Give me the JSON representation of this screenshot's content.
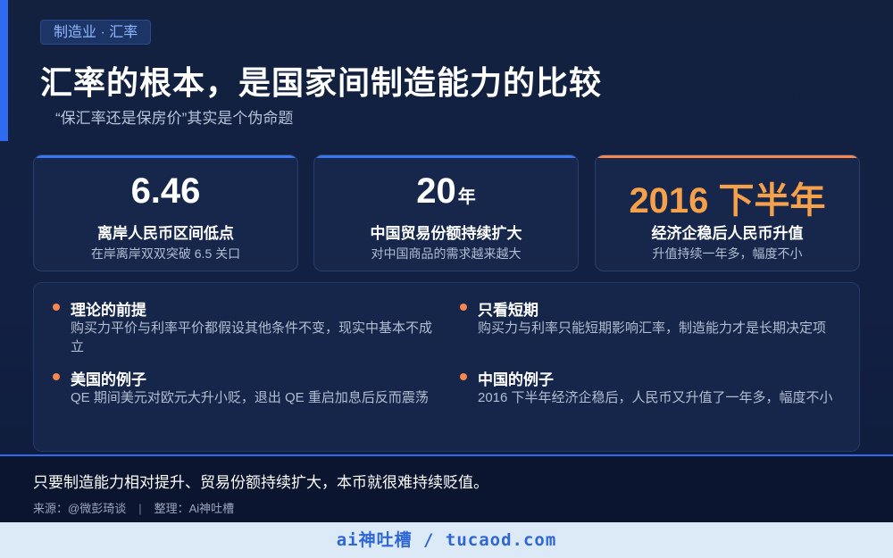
{
  "header": {
    "tag": "制造业 · 汇率",
    "title": "汇率的根本，是国家间制造能力的比较",
    "subtitle": "“保汇率还是保房价”其实是个伪命题"
  },
  "stats": [
    {
      "value": "6.46",
      "unit": "",
      "label": "离岸人民币区间低点",
      "desc": "在岸离岸双双突破 6.5 关口"
    },
    {
      "value": "20",
      "unit": "年",
      "label": "中国贸易份额持续扩大",
      "desc": "对中国商品的需求越来越大"
    },
    {
      "value": "2016 下半年",
      "unit": "",
      "label": "经济企稳后人民币升值",
      "desc": "升值持续一年多，幅度不小"
    }
  ],
  "points": [
    {
      "heading": "理论的前提",
      "body": "购买力平价与利率平价都假设其他条件不变，现实中基本不成立"
    },
    {
      "heading": "只看短期",
      "body": "购买力与利率只能短期影响汇率，制造能力才是长期决定项"
    },
    {
      "heading": "美国的例子",
      "body": "QE 期间美元对欧元大升小贬，退出 QE 重启加息后反而震荡"
    },
    {
      "heading": "中国的例子",
      "body": "2016 下半年经济企稳后，人民币又升值了一年多，幅度不小"
    }
  ],
  "bottom": {
    "quote": "只要制造能力相对提升、贸易份额持续扩大，本币就很难持续贬值。",
    "source": "来源：@微彭琦谈",
    "separator": "|",
    "editor": "整理：Ai神吐槽"
  },
  "footer": {
    "text": "ai神吐槽 / tucaod.com"
  },
  "colors": {
    "accent_blue": "#2e6bf0",
    "accent_orange": "#f5874f",
    "highlight_orange": "#f5a04a"
  }
}
